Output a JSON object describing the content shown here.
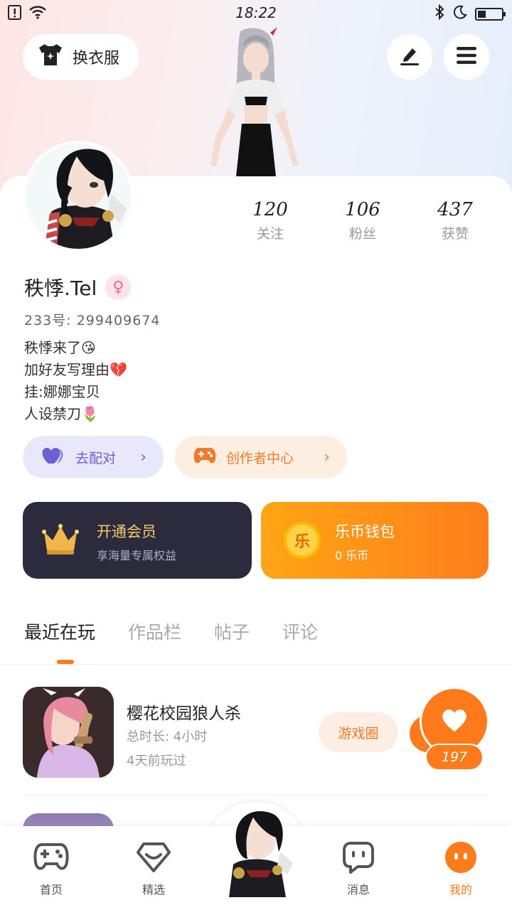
{
  "status_bar": {
    "time": "18:22",
    "battery_level": 0.35
  },
  "header": {
    "outfit_label": "换衣服",
    "edit_icon": "pen-icon",
    "menu_icon": "menu-icon"
  },
  "stats": [
    {
      "value": "120",
      "label": "关注"
    },
    {
      "value": "106",
      "label": "粉丝"
    },
    {
      "value": "437",
      "label": "获赞"
    }
  ],
  "profile": {
    "name": "秩悸.Tel",
    "gender_icon": "female-icon",
    "uid": "233号: 299409674",
    "bio": [
      "秩悸来了😘",
      "加好友写理由💔",
      "挂:娜娜宝贝",
      "人设禁刀🌷"
    ]
  },
  "actions": {
    "match_label": "去配对",
    "creator_label": "创作者中心"
  },
  "promo": {
    "vip_title": "开通会员",
    "vip_subtitle": "享海量专属权益",
    "coin_title": "乐币钱包",
    "coin_subtitle": "0 乐币",
    "coin_glyph": "乐"
  },
  "tabs": [
    "最近在玩",
    "作品栏",
    "帖子",
    "评论"
  ],
  "games": [
    {
      "title": "樱花校园狼人杀",
      "duration": "总时长: 4小时",
      "last_played": "4天前玩过",
      "circle_label": "游戏圈",
      "likes": "197"
    }
  ],
  "nav": [
    {
      "label": "首页",
      "icon": "gamepad-icon"
    },
    {
      "label": "精选",
      "icon": "heart-badge-icon"
    },
    {
      "label": "",
      "icon": "avatar-center"
    },
    {
      "label": "消息",
      "icon": "chat-icon"
    },
    {
      "label": "我的",
      "icon": "profile-face-icon"
    }
  ],
  "colors": {
    "accent": "#ff7a1a",
    "match": "#6a61d6",
    "vip_bg": "#2b2b3d",
    "gold": "#f4c96a"
  }
}
